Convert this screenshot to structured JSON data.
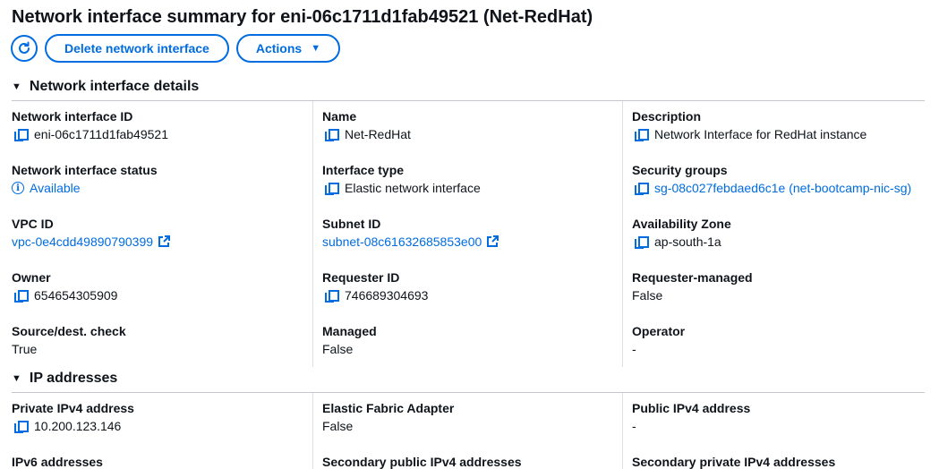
{
  "page": {
    "title": "Network interface summary for eni-06c1711d1fab49521 (Net-RedHat)"
  },
  "toolbar": {
    "refresh_icon": "refresh-icon",
    "delete_label": "Delete network interface",
    "actions_label": "Actions"
  },
  "sections": {
    "details_title": "Network interface details",
    "ip_title": "IP addresses"
  },
  "details": {
    "eni_id": {
      "label": "Network interface ID",
      "value": "eni-06c1711d1fab49521"
    },
    "name": {
      "label": "Name",
      "value": "Net-RedHat"
    },
    "description": {
      "label": "Description",
      "value": "Network Interface for RedHat instance"
    },
    "status": {
      "label": "Network interface status",
      "value": "Available"
    },
    "interface_type": {
      "label": "Interface type",
      "value": "Elastic network interface"
    },
    "security_groups": {
      "label": "Security groups",
      "value": "sg-08c027febdaed6c1e (net-bootcamp-nic-sg)"
    },
    "vpc_id": {
      "label": "VPC ID",
      "value": "vpc-0e4cdd49890790399"
    },
    "subnet_id": {
      "label": "Subnet ID",
      "value": "subnet-08c61632685853e00"
    },
    "az": {
      "label": "Availability Zone",
      "value": "ap-south-1a"
    },
    "owner": {
      "label": "Owner",
      "value": "654654305909"
    },
    "requester_id": {
      "label": "Requester ID",
      "value": "746689304693"
    },
    "requester_managed": {
      "label": "Requester-managed",
      "value": "False"
    },
    "source_dest": {
      "label": "Source/dest. check",
      "value": "True"
    },
    "managed": {
      "label": "Managed",
      "value": "False"
    },
    "operator": {
      "label": "Operator",
      "value": "-"
    }
  },
  "ip": {
    "private_ipv4": {
      "label": "Private IPv4 address",
      "value": "10.200.123.146"
    },
    "efa": {
      "label": "Elastic Fabric Adapter",
      "value": "False"
    },
    "public_ipv4": {
      "label": "Public IPv4 address",
      "value": "-"
    },
    "ipv6": {
      "label": "IPv6 addresses"
    },
    "secondary_public": {
      "label": "Secondary public IPv4 addresses"
    },
    "secondary_private": {
      "label": "Secondary private IPv4 addresses"
    }
  },
  "colors": {
    "link": "#006ce0",
    "text": "#0f141a",
    "divider": "#c6c6cd"
  }
}
